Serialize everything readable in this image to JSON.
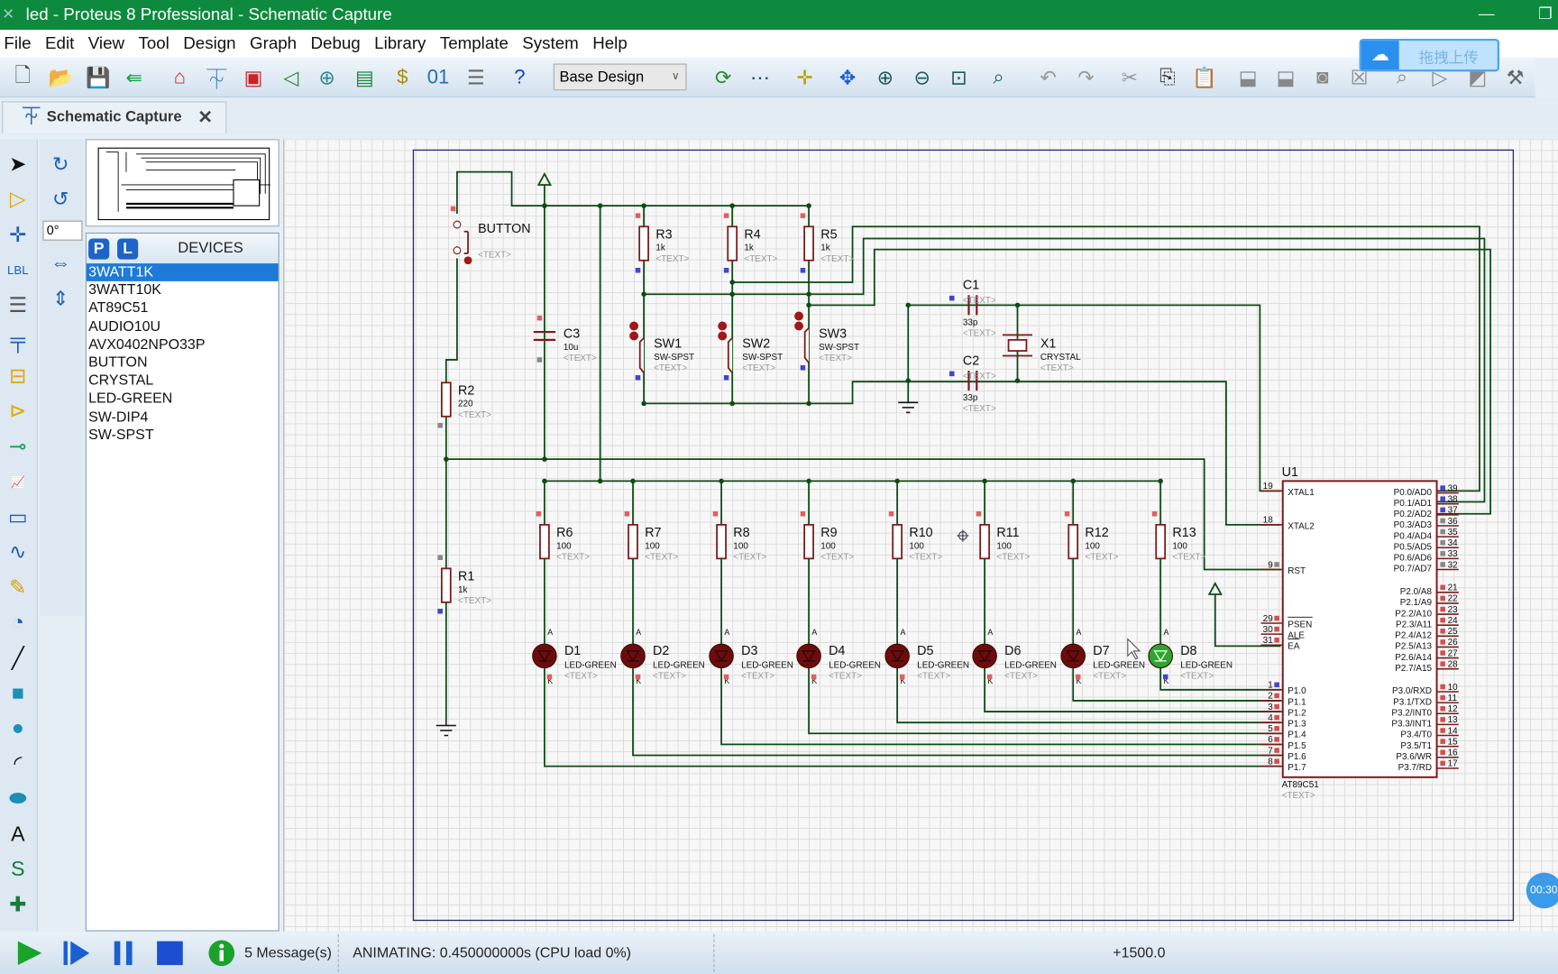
{
  "window": {
    "title": "led - Proteus 8 Professional - Schematic Capture",
    "minimize_icon": "minimize-icon",
    "restore_icon": "restore-icon"
  },
  "menu": [
    "File",
    "Edit",
    "View",
    "Tool",
    "Design",
    "Graph",
    "Debug",
    "Library",
    "Template",
    "System",
    "Help"
  ],
  "toolbar": {
    "design_select": "Base Design",
    "upload_label": "拖拽上传"
  },
  "tab": {
    "label": "Schematic Capture"
  },
  "rotation": "0°",
  "devices": {
    "title": "DEVICES",
    "p": "P",
    "l": "L",
    "selected": "3WATT1K",
    "items": [
      "3WATT1K",
      "3WATT10K",
      "AT89C51",
      "AUDIO10U",
      "AVX0402NPO33P",
      "BUTTON",
      "CRYSTAL",
      "LED-GREEN",
      "SW-DIP4",
      "SW-SPST"
    ]
  },
  "status": {
    "messages": "5 Message(s)",
    "animating": "ANIMATING: 0.450000000s (CPU load 0%)",
    "coord": "+1500.0",
    "timer": "00:30"
  },
  "colors": {
    "wire": "#0d4a14",
    "part": "#7a1a1a",
    "led_off": "#6e0c0c",
    "led_on": "#2ea52e",
    "title_bar": "#0e8a3e"
  },
  "schematic": {
    "placeholder": "<TEXT>",
    "button": {
      "ref": "BUTTON"
    },
    "r2": {
      "ref": "R2",
      "value": "220"
    },
    "r1": {
      "ref": "R1",
      "value": "1k"
    },
    "c3": {
      "ref": "C3",
      "value": "10u"
    },
    "c1": {
      "ref": "C1",
      "value": "33p"
    },
    "c2": {
      "ref": "C2",
      "value": "33p"
    },
    "x1": {
      "ref": "X1",
      "value": "CRYSTAL"
    },
    "pullups": [
      {
        "ref": "R3",
        "value": "1k"
      },
      {
        "ref": "R4",
        "value": "1k"
      },
      {
        "ref": "R5",
        "value": "1k"
      }
    ],
    "switches": [
      {
        "ref": "SW1",
        "value": "SW-SPST"
      },
      {
        "ref": "SW2",
        "value": "SW-SPST"
      },
      {
        "ref": "SW3",
        "value": "SW-SPST"
      }
    ],
    "led_resistors": [
      {
        "ref": "R6",
        "value": "100"
      },
      {
        "ref": "R7",
        "value": "100"
      },
      {
        "ref": "R8",
        "value": "100"
      },
      {
        "ref": "R9",
        "value": "100"
      },
      {
        "ref": "R10",
        "value": "100"
      },
      {
        "ref": "R11",
        "value": "100"
      },
      {
        "ref": "R12",
        "value": "100"
      },
      {
        "ref": "R13",
        "value": "100"
      }
    ],
    "leds": [
      {
        "ref": "D1",
        "value": "LED-GREEN",
        "lit": false
      },
      {
        "ref": "D2",
        "value": "LED-GREEN",
        "lit": false
      },
      {
        "ref": "D3",
        "value": "LED-GREEN",
        "lit": false
      },
      {
        "ref": "D4",
        "value": "LED-GREEN",
        "lit": false
      },
      {
        "ref": "D5",
        "value": "LED-GREEN",
        "lit": false
      },
      {
        "ref": "D6",
        "value": "LED-GREEN",
        "lit": false
      },
      {
        "ref": "D7",
        "value": "LED-GREEN",
        "lit": false
      },
      {
        "ref": "D8",
        "value": "LED-GREEN",
        "lit": true
      }
    ],
    "u1": {
      "ref": "U1",
      "part": "AT89C51",
      "left_pins": [
        {
          "num": "19",
          "name": "XTAL1"
        },
        {
          "num": "18",
          "name": "XTAL2"
        },
        {
          "num": "9",
          "name": "RST"
        },
        {
          "num": "29",
          "name": "PSEN"
        },
        {
          "num": "30",
          "name": "ALE"
        },
        {
          "num": "31",
          "name": "EA"
        },
        {
          "num": "1",
          "name": "P1.0"
        },
        {
          "num": "2",
          "name": "P1.1"
        },
        {
          "num": "3",
          "name": "P1.2"
        },
        {
          "num": "4",
          "name": "P1.3"
        },
        {
          "num": "5",
          "name": "P1.4"
        },
        {
          "num": "6",
          "name": "P1.5"
        },
        {
          "num": "7",
          "name": "P1.6"
        },
        {
          "num": "8",
          "name": "P1.7"
        }
      ],
      "right_pins": [
        {
          "num": "39",
          "name": "P0.0/AD0"
        },
        {
          "num": "38",
          "name": "P0.1/AD1"
        },
        {
          "num": "37",
          "name": "P0.2/AD2"
        },
        {
          "num": "36",
          "name": "P0.3/AD3"
        },
        {
          "num": "35",
          "name": "P0.4/AD4"
        },
        {
          "num": "34",
          "name": "P0.5/AD5"
        },
        {
          "num": "33",
          "name": "P0.6/AD6"
        },
        {
          "num": "32",
          "name": "P0.7/AD7"
        },
        {
          "num": "21",
          "name": "P2.0/A8"
        },
        {
          "num": "22",
          "name": "P2.1/A9"
        },
        {
          "num": "23",
          "name": "P2.2/A10"
        },
        {
          "num": "24",
          "name": "P2.3/A11"
        },
        {
          "num": "25",
          "name": "P2.4/A12"
        },
        {
          "num": "26",
          "name": "P2.5/A13"
        },
        {
          "num": "27",
          "name": "P2.6/A14"
        },
        {
          "num": "28",
          "name": "P2.7/A15"
        },
        {
          "num": "10",
          "name": "P3.0/RXD"
        },
        {
          "num": "11",
          "name": "P3.1/TXD"
        },
        {
          "num": "12",
          "name": "P3.2/INT0"
        },
        {
          "num": "13",
          "name": "P3.3/INT1"
        },
        {
          "num": "14",
          "name": "P3.4/T0"
        },
        {
          "num": "15",
          "name": "P3.5/T1"
        },
        {
          "num": "16",
          "name": "P3.6/WR"
        },
        {
          "num": "17",
          "name": "P3.7/RD"
        }
      ]
    }
  }
}
